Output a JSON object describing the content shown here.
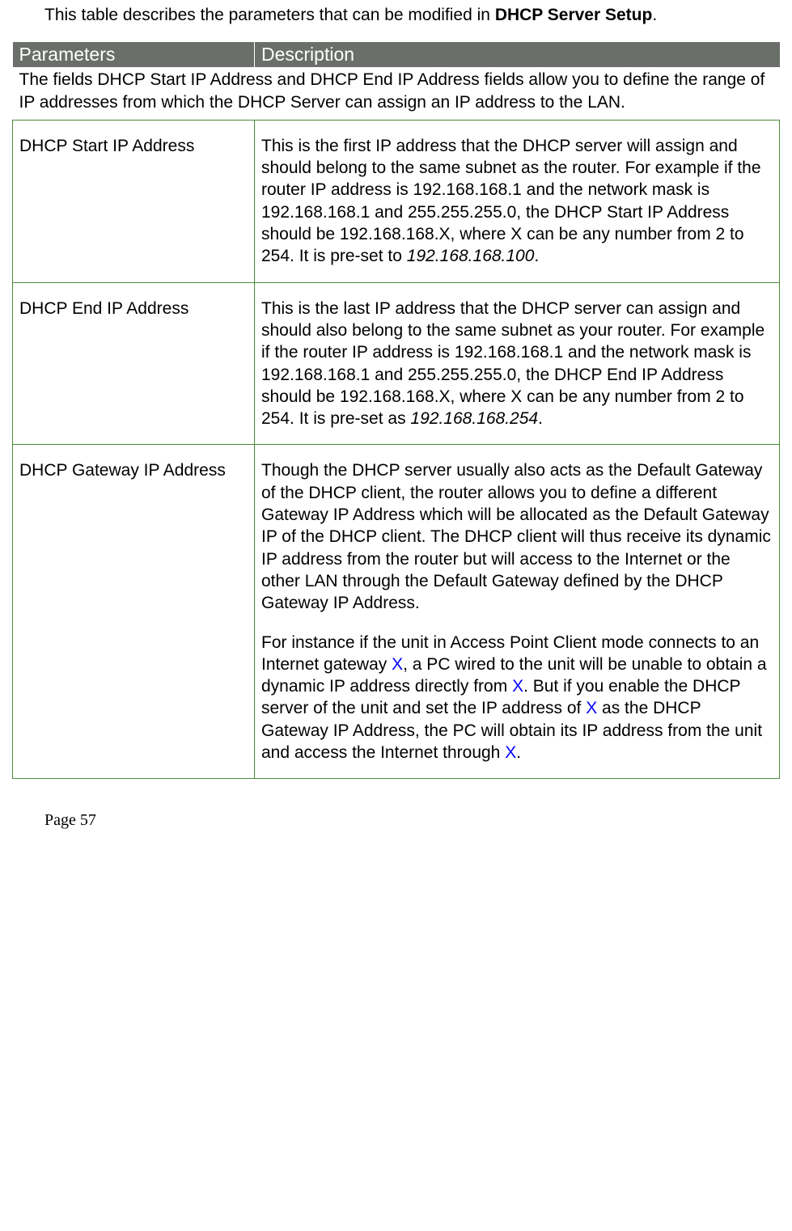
{
  "intro": {
    "text_before_bold": "This table describes the parameters that can be modified in ",
    "bold_text": "DHCP Server Setup",
    "text_after_bold": "."
  },
  "table": {
    "headers": {
      "col1": "Parameters",
      "col2": "Description"
    },
    "span_row": "The fields DHCP Start IP Address and DHCP End IP Address fields allow you to define the range of IP addresses from which the DHCP Server can assign an IP address to the LAN.",
    "rows": [
      {
        "param": "DHCP Start IP Address",
        "desc_prefix": "This is the first IP address that the DHCP server will assign and should belong to the same subnet as the router. For example if the router IP address is 192.168.168.1 and the network mask is 192.168.168.1 and 255.255.255.0, the DHCP Start IP Address should be 192.168.168.X, where X can be any number from 2 to 254. It is pre-set to ",
        "desc_italic": "192.168.168.100",
        "desc_suffix": "."
      },
      {
        "param": "DHCP End IP Address",
        "desc_prefix": "This is the last IP address that the DHCP server can assign and should also belong to the same subnet as your router. For example if the router IP address is 192.168.168.1 and the network mask is 192.168.168.1 and 255.255.255.0, the DHCP End IP Address should be 192.168.168.X, where X can be any number from 2 to 254. It is pre-set as ",
        "desc_italic": "192.168.168.254",
        "desc_suffix": "."
      },
      {
        "param": "DHCP Gateway IP Address",
        "gateway": {
          "p1": "Though the DHCP server usually also acts as the Default Gateway of the DHCP client, the router allows you to define a different Gateway IP Address which will be allocated as the Default Gateway IP of the DHCP client. The DHCP client will thus receive its dynamic IP address from the router but will access to the Internet or the other LAN through the Default Gateway defined by the DHCP Gateway IP Address.",
          "p2_a": "For instance if the unit in Access Point Client mode connects to an Internet gateway ",
          "p2_x1": "X",
          "p2_b": ", a PC wired to the unit will be unable to obtain a dynamic IP address directly from ",
          "p2_x2": "X",
          "p2_c": ".   But if you enable the DHCP server of the unit and set the IP address of ",
          "p2_x3": "X",
          "p2_d": " as the DHCP Gateway IP Address, the PC will obtain its IP address from the unit and access the Internet through ",
          "p2_x4": "X",
          "p2_e": "."
        }
      }
    ]
  },
  "page_number": "Page 57"
}
